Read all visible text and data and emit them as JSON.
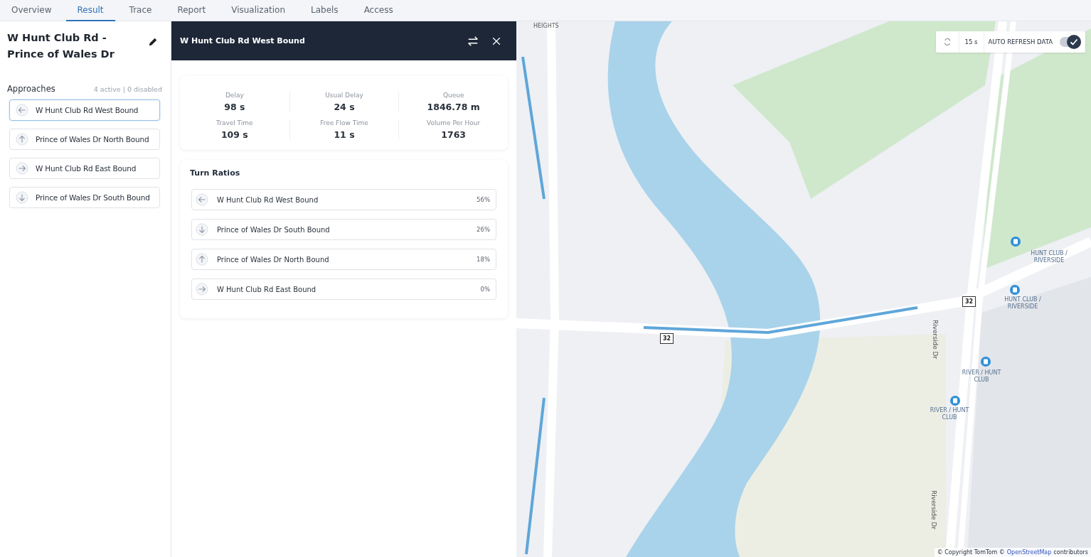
{
  "tabs": [
    {
      "label": "Overview",
      "selected": false
    },
    {
      "label": "Result",
      "selected": true
    },
    {
      "label": "Trace",
      "selected": false
    },
    {
      "label": "Report",
      "selected": false
    },
    {
      "label": "Visualization",
      "selected": false
    },
    {
      "label": "Labels",
      "selected": false
    },
    {
      "label": "Access",
      "selected": false
    }
  ],
  "intersection": {
    "title": "W Hunt Club Rd - Prince of Wales Dr"
  },
  "approaches": {
    "heading": "Approaches",
    "summary": "4 active | 0 disabled",
    "items": [
      {
        "label": "W Hunt Club Rd West Bound",
        "kind": "west",
        "selected": true
      },
      {
        "label": "Prince of Wales Dr North Bound",
        "kind": "north",
        "selected": false
      },
      {
        "label": "W Hunt Club Rd East Bound",
        "kind": "east",
        "selected": false
      },
      {
        "label": "Prince of Wales Dr South Bound",
        "kind": "south",
        "selected": false
      }
    ]
  },
  "detail": {
    "title": "W Hunt Club Rd West Bound",
    "metrics": [
      {
        "label": "Delay",
        "value": "98 s"
      },
      {
        "label": "Usual Delay",
        "value": "24 s"
      },
      {
        "label": "Queue",
        "value": "1846.78 m"
      },
      {
        "label": "Travel Time",
        "value": "109 s"
      },
      {
        "label": "Free Flow Time",
        "value": "11 s"
      },
      {
        "label": "Volume Per Hour",
        "value": "1763"
      }
    ],
    "turn_ratios": {
      "heading": "Turn Ratios",
      "items": [
        {
          "label": "W Hunt Club Rd West Bound",
          "kind": "west",
          "ratio": "56%"
        },
        {
          "label": "Prince of Wales Dr South Bound",
          "kind": "south",
          "ratio": "26%"
        },
        {
          "label": "Prince of Wales Dr North Bound",
          "kind": "north",
          "ratio": "18%"
        },
        {
          "label": "W Hunt Club Rd East Bound",
          "kind": "east",
          "ratio": "0%"
        }
      ]
    }
  },
  "map": {
    "refresh": {
      "interval": "15 s",
      "label": "AUTO REFRESH DATA",
      "on": true
    },
    "labels": [
      {
        "text": "HEIGHTS",
        "kind": "area"
      },
      {
        "text": "HUNT CLUB / RIVERSIDE",
        "kind": "stop"
      },
      {
        "text": "HUNT CLUB / RIVERSIDE",
        "kind": "stop"
      },
      {
        "text": "RIVER / HUNT CLUB",
        "kind": "stop"
      },
      {
        "text": "RIVER / HUNT CLUB",
        "kind": "stop"
      },
      {
        "text": "Riverside Dr",
        "kind": "street"
      },
      {
        "text": "Riverside Dr",
        "kind": "street"
      },
      {
        "text": "32",
        "kind": "shield"
      },
      {
        "text": "32",
        "kind": "shield"
      }
    ],
    "attribution": {
      "text": "© Copyright TomTom ©",
      "link": "OpenStreetMap",
      "suffix": "contributors"
    }
  }
}
